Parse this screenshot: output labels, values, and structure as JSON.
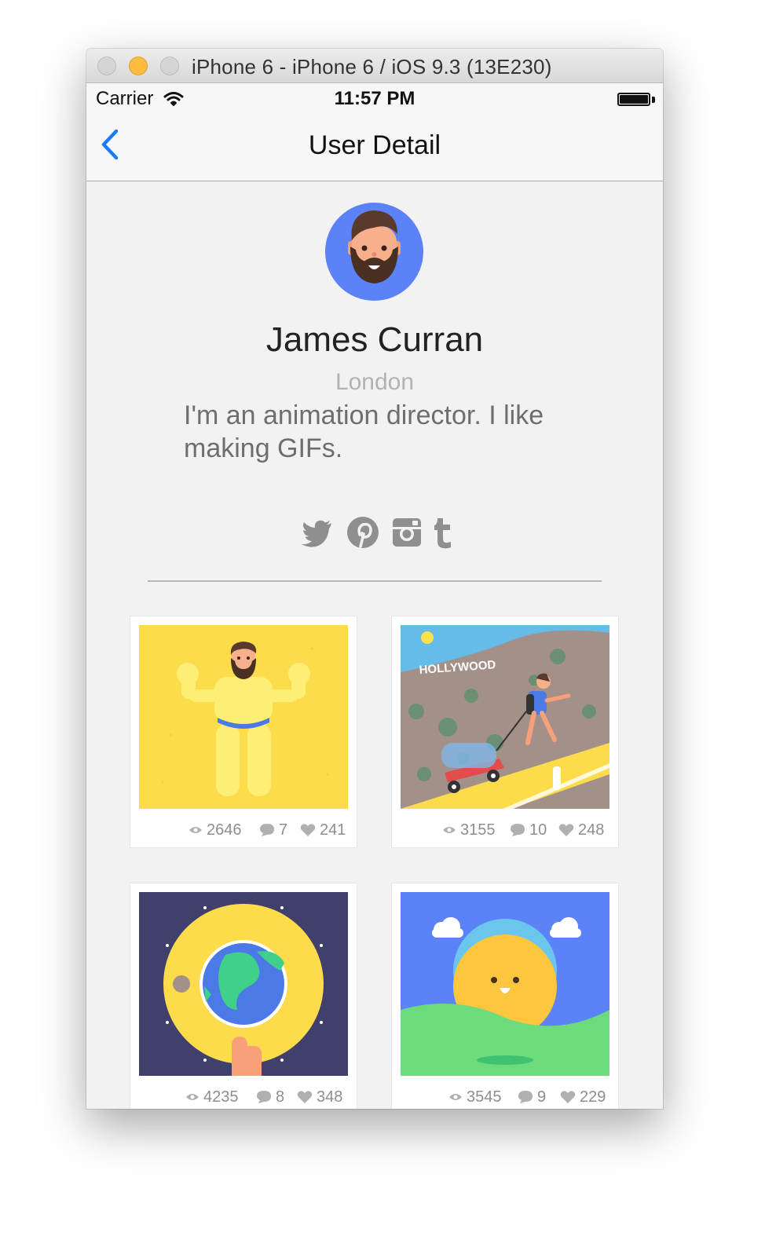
{
  "window": {
    "title": "iPhone 6 - iPhone 6 / iOS 9.3 (13E230)"
  },
  "status_bar": {
    "carrier": "Carrier",
    "time": "11:57 PM"
  },
  "nav": {
    "title": "User Detail"
  },
  "user": {
    "name": "James Curran",
    "location": "London",
    "bio": "I'm an animation director. I like making GIFs."
  },
  "social_links": [
    "twitter-icon",
    "pinterest-icon",
    "instagram-icon",
    "tumblr-icon"
  ],
  "colors": {
    "tint": "#1a7cf5",
    "avatar_bg": "#5b82f7",
    "stat_gray": "#8e8e8e"
  },
  "shots": [
    {
      "art": "muscle-man",
      "views": "2646",
      "comments": "7",
      "likes": "241"
    },
    {
      "art": "hollywood-hike",
      "views": "3155",
      "comments": "10",
      "likes": "248"
    },
    {
      "art": "earth-lens",
      "views": "4235",
      "comments": "8",
      "likes": "348"
    },
    {
      "art": "sun-hill",
      "views": "3545",
      "comments": "9",
      "likes": "229"
    }
  ]
}
